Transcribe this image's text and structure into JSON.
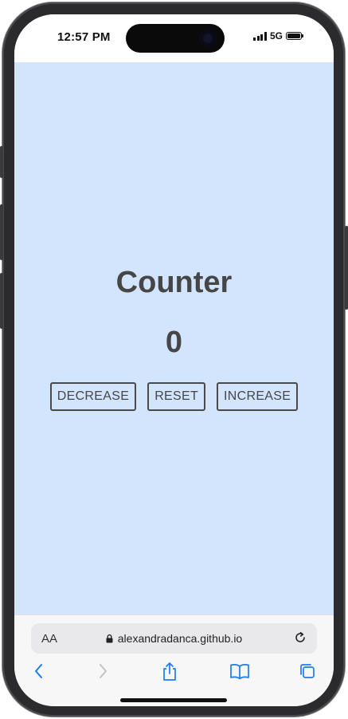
{
  "status_bar": {
    "time": "12:57 PM",
    "network": "5G"
  },
  "page": {
    "title": "Counter",
    "count": "0",
    "buttons": {
      "decrease": "DECREASE",
      "reset": "RESET",
      "increase": "INCREASE"
    }
  },
  "browser": {
    "text_size_label": "AA",
    "url": "alexandradanca.github.io",
    "icons": {
      "lock": "lock-icon",
      "reload": "reload-icon",
      "back": "chevron-left-icon",
      "forward": "chevron-right-icon",
      "share": "share-icon",
      "bookmarks": "book-icon",
      "tabs": "tabs-icon"
    }
  },
  "colors": {
    "page_background": "#d2e5fd",
    "text": "#464646",
    "accent": "#1a7cf5"
  }
}
